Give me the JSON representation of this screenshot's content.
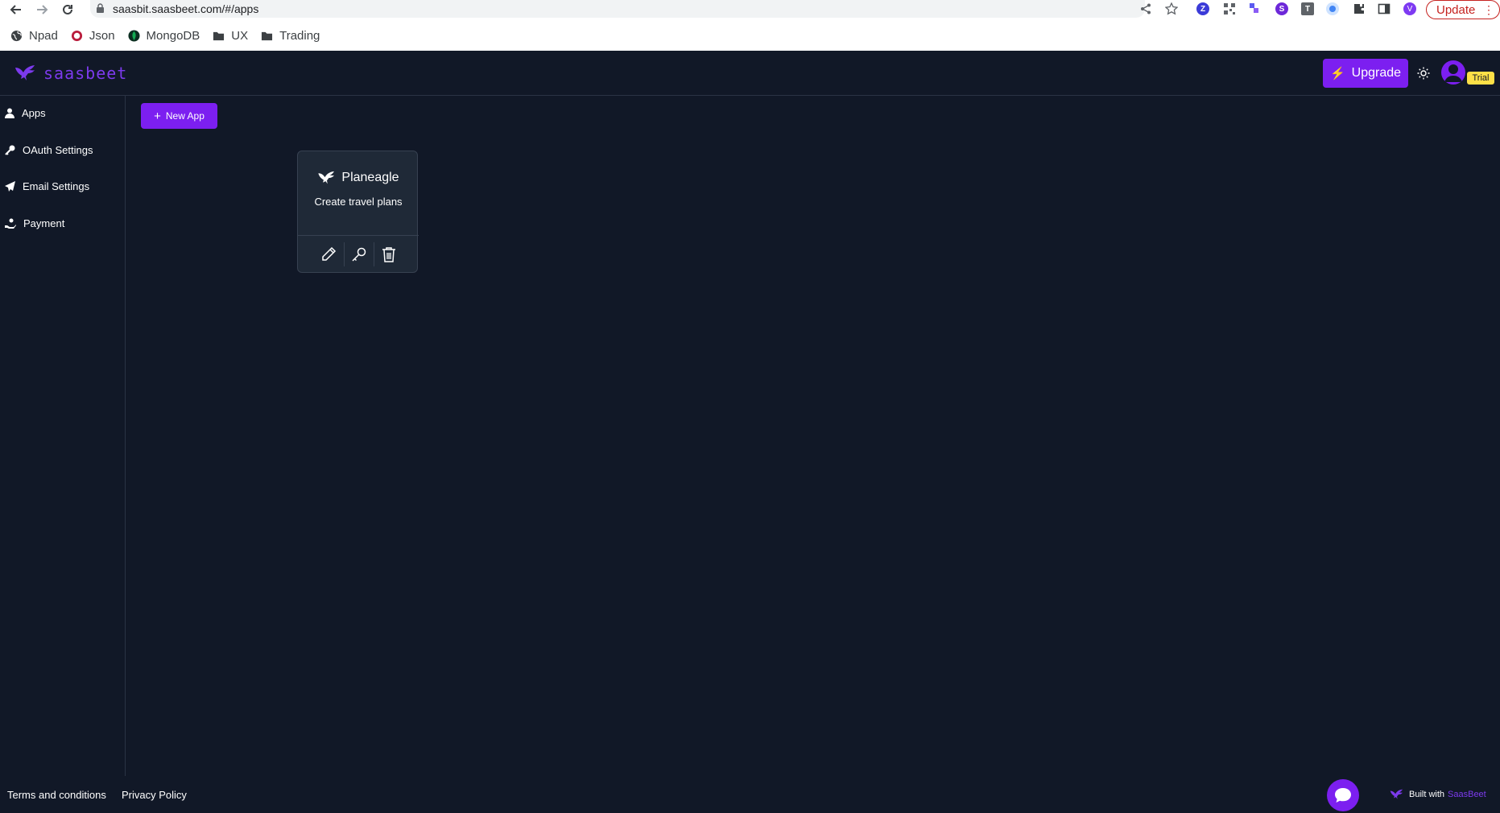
{
  "browser": {
    "url": "saasbit.saasbeet.com/#/apps",
    "update_label": "Update",
    "extensions": [
      "Z",
      "S",
      "T",
      "V"
    ],
    "bookmarks": [
      {
        "label": "Npad",
        "icon": "globe-icon"
      },
      {
        "label": "Json",
        "icon": "circle-logo-icon"
      },
      {
        "label": "MongoDB",
        "icon": "leaf-icon"
      },
      {
        "label": "UX",
        "icon": "folder-icon"
      },
      {
        "label": "Trading",
        "icon": "folder-icon"
      }
    ]
  },
  "header": {
    "logo_text": "saasbeet",
    "upgrade_label": "Upgrade",
    "trial_label": "Trial"
  },
  "sidebar": {
    "items": [
      {
        "label": "Apps",
        "icon": "user-icon"
      },
      {
        "label": "OAuth Settings",
        "icon": "key-icon"
      },
      {
        "label": "Email Settings",
        "icon": "paper-plane-icon"
      },
      {
        "label": "Payment",
        "icon": "hand-coin-icon"
      }
    ]
  },
  "main": {
    "new_app_label": "New App",
    "apps": [
      {
        "name": "Planeagle",
        "description": "Create travel plans",
        "actions": [
          "pencil-icon",
          "key-icon",
          "trash-icon"
        ]
      }
    ]
  },
  "footer": {
    "terms_label": "Terms and conditions",
    "privacy_label": "Privacy Policy",
    "built_with_label": "Built with",
    "built_with_brand": "SaasBeet"
  },
  "colors": {
    "background": "#111827",
    "accent": "#7c1ff0",
    "card": "#1f2937",
    "trial": "#fde047"
  }
}
